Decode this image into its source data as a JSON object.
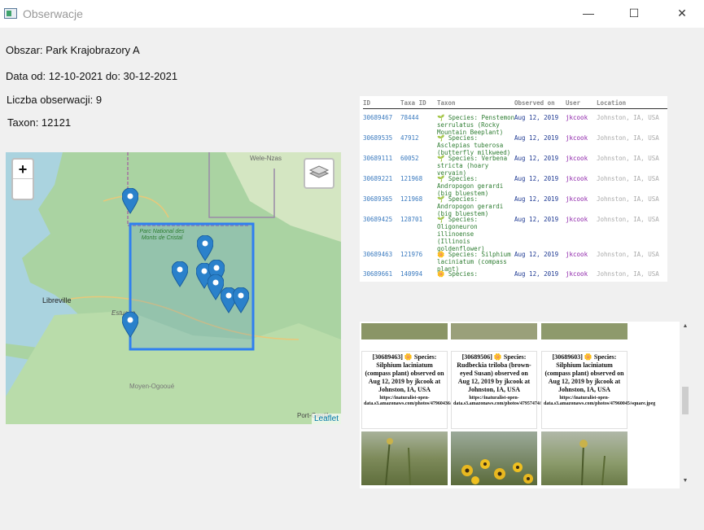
{
  "window": {
    "title": "Obserwacje",
    "minimize": "—",
    "maximize": "☐",
    "close": "✕"
  },
  "info": {
    "area": "Obszar: Park Krajobrazory A",
    "dates": "Data od: 12-10-2021 do: 30-12-2021",
    "count": "Liczba obserwacji: 9",
    "taxon": "Taxon: 12121"
  },
  "map": {
    "zoom_in": "+",
    "zoom_out": "",
    "labels": {
      "city": "Libreville",
      "park": "Parc National des Monts de Cristal",
      "estuaire": "Estuaire",
      "region_top": "Wele-Nzas",
      "region_bottom": "Moyen-Ogooué",
      "port": "Port-Gentil"
    },
    "attribution": "Leaflet"
  },
  "table": {
    "columns": [
      "ID",
      "Taxa ID",
      "Taxon",
      "Observed on",
      "User",
      "Location"
    ],
    "rows": [
      {
        "id": "30689467",
        "taxa_id": "78444",
        "taxon": "🌱 Species: Penstemon\nserrulatus (Rocky\nMountain Beeplant)",
        "observed": "Aug 12, 2019",
        "user": "jkcook",
        "location": "Johnston, IA, USA"
      },
      {
        "id": "30689535",
        "taxa_id": "47912",
        "taxon": "🌱 Species:\nAsclepias tuberosa\n(butterfly milkweed)",
        "observed": "Aug 12, 2019",
        "user": "jkcook",
        "location": "Johnston, IA, USA"
      },
      {
        "id": "30689111",
        "taxa_id": "60052",
        "taxon": "🌱 Species: Verbena\nstricta (hoary\nvervain)",
        "observed": "Aug 12, 2019",
        "user": "jkcook",
        "location": "Johnston, IA, USA"
      },
      {
        "id": "30689221",
        "taxa_id": "121968",
        "taxon": "🌱 Species:\nAndropogon gerardi\n(big bluestem)",
        "observed": "Aug 12, 2019",
        "user": "jkcook",
        "location": "Johnston, IA, USA"
      },
      {
        "id": "30689365",
        "taxa_id": "121968",
        "taxon": "🌱 Species:\nAndropogon gerardi\n(big bluestem)",
        "observed": "Aug 12, 2019",
        "user": "jkcook",
        "location": "Johnston, IA, USA"
      },
      {
        "id": "30689425",
        "taxa_id": "128701",
        "taxon": "🌱 Species:\nOligoneuron\nillinoense\n(Illinois\ngoldenflower)",
        "observed": "Aug 12, 2019",
        "user": "jkcook",
        "location": "Johnston, IA, USA"
      },
      {
        "id": "30689463",
        "taxa_id": "121976",
        "taxon": "🌼 Species: Silphium\nlaciniatum (compass\nplant)",
        "observed": "Aug 12, 2019",
        "user": "jkcook",
        "location": "Johnston, IA, USA"
      },
      {
        "id": "30689661",
        "taxa_id": "140994",
        "taxon": "🌼 Species:",
        "observed": "Aug 12, 2019",
        "user": "jkcook",
        "location": "Johnston, IA, USA"
      }
    ]
  },
  "gallery": {
    "cards": [
      {
        "caption": "[30689463] 🌼 Species: Silphium laciniatum (compass plant) observed on Aug 12, 2019 by jkcook at Johnston, IA, USA",
        "url": "https://inaturalist-open-data.s3.amazonaws.com/photos/47960436/square.jpeg"
      },
      {
        "caption": "[30689506] 🌼 Species: Rudbeckia triloba (brown-eyed Susan) observed on Aug 12, 2019 by jkcook at Johnston, IA, USA",
        "url": "https://inaturalist-open-data.s3.amazonaws.com/photos/47957474/square.jpeg"
      },
      {
        "caption": "[30689603] 🌼 Species: Silphium laciniatum (compass plant) observed on Aug 12, 2019 by jkcook at Johnston, IA, USA",
        "url": "https://inaturalist-open-data.s3.amazonaws.com/photos/47960045/square.jpeg"
      }
    ],
    "scroll_up": "▲",
    "scroll_down": "▼"
  }
}
